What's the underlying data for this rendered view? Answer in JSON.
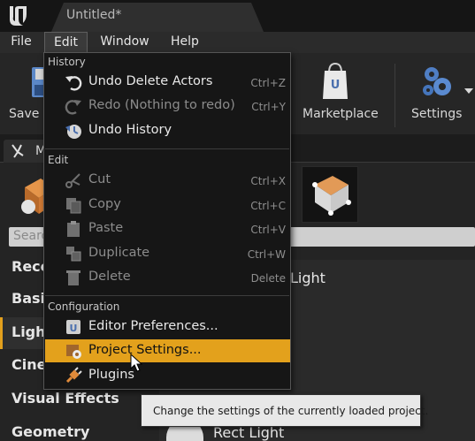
{
  "window": {
    "tab_title": "Untitled",
    "tab_dirty_mark": "*"
  },
  "menubar": {
    "items": [
      "File",
      "Edit",
      "Window",
      "Help"
    ],
    "active": "Edit"
  },
  "toolbar": {
    "buttons": [
      {
        "label": "Save C",
        "icon": "floppy-icon"
      },
      {
        "label": "Marketplace",
        "icon": "shopping-bag-icon"
      },
      {
        "label": "Settings",
        "icon": "gears-icon"
      }
    ]
  },
  "modes": {
    "tab_label": "M",
    "search_placeholder": "Search",
    "categories": [
      "Rece",
      "Basi",
      "Light",
      "Cine",
      "Visual Effects",
      "Geometry"
    ],
    "selected_category": "Light",
    "items": [
      "Light",
      "Rect Light"
    ]
  },
  "edit_menu": {
    "sections": [
      {
        "header": "History",
        "items": [
          {
            "label": "Undo Delete Actors",
            "shortcut": "Ctrl+Z",
            "icon": "undo-icon",
            "enabled": true
          },
          {
            "label": "Redo (Nothing to redo)",
            "shortcut": "Ctrl+Y",
            "icon": "redo-icon",
            "enabled": false
          },
          {
            "label": "Undo History",
            "shortcut": "",
            "icon": "history-icon",
            "enabled": true
          }
        ]
      },
      {
        "header": "Edit",
        "items": [
          {
            "label": "Cut",
            "shortcut": "Ctrl+X",
            "icon": "scissors-icon",
            "enabled": false
          },
          {
            "label": "Copy",
            "shortcut": "Ctrl+C",
            "icon": "copy-icon",
            "enabled": false
          },
          {
            "label": "Paste",
            "shortcut": "Ctrl+V",
            "icon": "paste-icon",
            "enabled": false
          },
          {
            "label": "Duplicate",
            "shortcut": "Ctrl+W",
            "icon": "duplicate-icon",
            "enabled": false
          },
          {
            "label": "Delete",
            "shortcut": "Delete",
            "icon": "trash-icon",
            "enabled": false
          }
        ]
      },
      {
        "header": "Configuration",
        "items": [
          {
            "label": "Editor Preferences...",
            "shortcut": "",
            "icon": "preferences-icon",
            "enabled": true
          },
          {
            "label": "Project Settings...",
            "shortcut": "",
            "icon": "project-settings-icon",
            "enabled": true,
            "hovered": true
          },
          {
            "label": "Plugins",
            "shortcut": "",
            "icon": "plug-icon",
            "enabled": true
          }
        ]
      }
    ]
  },
  "tooltip": {
    "text": "Change the settings of the currently loaded project."
  },
  "colors": {
    "highlight": "#e3a11c",
    "menu_bg": "#161616",
    "tooltip_bg": "#e8e8e8"
  }
}
